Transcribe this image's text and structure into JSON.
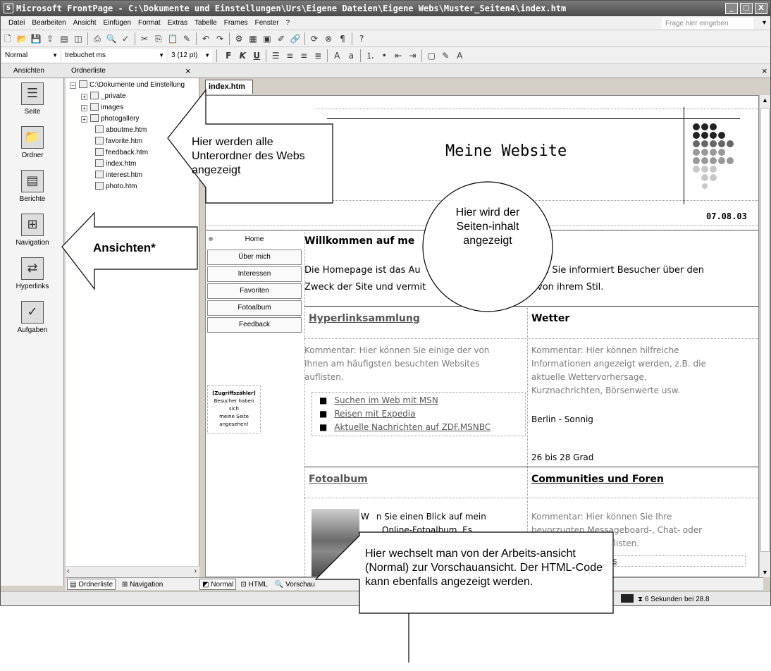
{
  "window": {
    "title": "Microsoft FrontPage - C:\\Dokumente und Einstellungen\\Urs\\Eigene Dateien\\Eigene Webs\\Muster_Seiten4\\index.htm",
    "app_icon": "S",
    "btn_min": "_",
    "btn_max": "□",
    "btn_close": "X"
  },
  "menu": [
    "Datei",
    "Bearbeiten",
    "Ansicht",
    "Einfügen",
    "Format",
    "Extras",
    "Tabelle",
    "Frames",
    "Fenster",
    "?"
  ],
  "help_placeholder": "Frage hier eingeben",
  "format_bar": {
    "style": "Normal",
    "font": "trebuchet ms",
    "size": "3 (12 pt)",
    "bold": "F",
    "italic": "K",
    "underline": "U"
  },
  "panes": {
    "views_title": "Ansichten",
    "folders_title": "Ordnerliste",
    "close_label": "×"
  },
  "views": [
    {
      "label": "Seite",
      "icon": "page-icon"
    },
    {
      "label": "Ordner",
      "icon": "folder-view-icon"
    },
    {
      "label": "Berichte",
      "icon": "reports-icon"
    },
    {
      "label": "Navigation",
      "icon": "navigation-icon"
    },
    {
      "label": "Hyperlinks",
      "icon": "hyperlinks-icon"
    },
    {
      "label": "Aufgaben",
      "icon": "tasks-icon"
    }
  ],
  "folder_tree": {
    "root": "C:\\Dokumente und Einstellung",
    "folders": [
      "_private",
      "images",
      "photogallery"
    ],
    "files": [
      "aboutme.htm",
      "favorite.htm",
      "feedback.htm",
      "index.htm",
      "interest.htm",
      "photo.htm"
    ]
  },
  "folder_tabs": {
    "list": "Ordnerliste",
    "nav": "Navigation"
  },
  "doc_tab": "index.htm",
  "view_tabs": {
    "normal": "Normal",
    "html": "HTML",
    "preview": "Vorschau"
  },
  "status": {
    "speed": "6 Sekunden bei 28.8"
  },
  "page": {
    "site_title": "Meine Website",
    "date": "07.08.03",
    "nav": [
      "Home",
      "Über mich",
      "Interessen",
      "Favoriten",
      "Fotoalbum",
      "Feedback"
    ],
    "counter_title": "[Zugriffszähler]",
    "counter_text": [
      "Besucher haben",
      "sich",
      "meine Seite",
      "angesehen!"
    ],
    "welcome_heading": "Willkommen auf me",
    "welcome_line1_a": "Die Homepage ist das Au",
    "welcome_line1_b": "te. Sie informiert Besucher über den",
    "welcome_line2_a": "Zweck der Site und vermit",
    "welcome_line2_b": "von ihrem Stil.",
    "links_heading": "Hyperlinksammlung",
    "links_comment": [
      "Kommentar: Hier können Sie einige der von",
      "Ihnen am häufigsten besuchten Websites",
      "auflisten."
    ],
    "links": [
      "Suchen im Web mit MSN",
      "Reisen mit Expedia",
      "Aktuelle Nachrichten auf ZDF.MSNBC"
    ],
    "weather_heading": "Wetter",
    "weather_comment": [
      "Kommentar: Hier können hilfreiche",
      "Informationen angezeigt werden, z.B. die",
      "aktuelle Wettervorhersage,",
      "Kurznachrichten, Börsenwerte usw."
    ],
    "weather_city": "Berlin - Sonnig",
    "weather_temp": "26 bis 28 Grad",
    "photo_heading": "Fotoalbum",
    "photo_text1": "n Sie einen Blick auf mein",
    "photo_text2": "Online-Fotoalbum. Es",
    "photo_text_prefix": "W",
    "community_heading": "Communities und Foren",
    "community_comment": [
      "Kommentar: Hier können Sie Ihre",
      "bevorzugten Messageboard-, Chat- oder",
      "n auflisten."
    ],
    "community_link": "nities"
  },
  "callouts": {
    "folders": "Hier werden alle Unterordner des Webs angezeigt",
    "views": "Ansichten*",
    "content": "Hier wird der Seiten-inhalt angezeigt",
    "viewtabs": "Hier wechselt man von der Arbeits-ansicht (Normal) zur Vorschauansicht. Der HTML-Code kann ebenfalls angezeigt werden."
  }
}
